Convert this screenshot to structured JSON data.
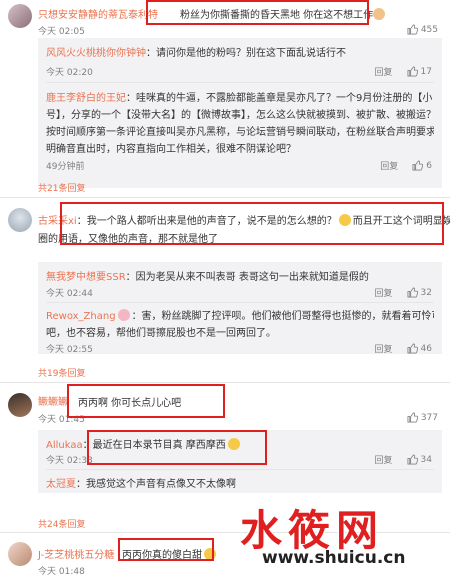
{
  "c1": {
    "name": "只想安安静静的蒂瓦泰利特",
    "text": "粉丝为你撕番撕的昏天黑地 你在这不想工作",
    "time": "今天 02:05",
    "likes": "455"
  },
  "c1_replies": [
    {
      "name": "风风火火桃桃你你钟钟",
      "text": "：请问你是他的粉吗？别在这下面乱说话行不",
      "time": "今天 02:20",
      "reply": "回复",
      "likes": "17"
    },
    {
      "name": "鹿王李舒白的王妃",
      "lines": [
        "：哇咪真的牛逼，不露脸都能盖章是吴亦凡了？一个9月份注册的【小",
        "号】，分享的一个【没带大名】的【微博故事】，怎么这么快就被摸到、被扩散、被搬运？且",
        "按时间顺序第一条评论直接叫吴亦凡黑称，与论坛营销号瞬间联动，在粉丝联合声明要求剧方",
        "明确音直出时，内容直指向工作相关，很难不阴谋论吧？"
      ],
      "time": "49分钟前",
      "reply": "回复",
      "likes": "6"
    }
  ],
  "c1_more": "共21条回复",
  "c2": {
    "name": "古采采xi",
    "lines": [
      "：我一个路人都听出来是他的声音了，说不是的怎么想的？",
      "而且开工这个词明显娱乐",
      "圈的用语，又像他的声音，那不就是他了"
    ]
  },
  "c2_replies": [
    {
      "name": "無我梦中想要SSR",
      "text": "：因为老吴从来不叫表哥 表哥这句一出来就知道是假的",
      "time": "今天 02:44",
      "reply": "回复",
      "likes": "32"
    },
    {
      "name": "Rewox_Zhang",
      "lines": [
        "：害，粉丝跳脚了控评呗。他们被他们哥整得也挺惨的，就看着可怜可怜",
        "吧，也不容易，帮他们哥擦屁股也不是一回两回了。"
      ],
      "time": "今天 02:55",
      "reply": "回复",
      "likes": "46"
    }
  ],
  "c2_more": "共19条回复",
  "c3": {
    "name": "鳜鳜鳜",
    "text": "丙丙啊 你可长点儿心吧",
    "time": "今天 01:45",
    "likes": "377"
  },
  "c3_replies": [
    {
      "name": "Allukaa",
      "text": "：最近在日本录节目真 摩西摩西",
      "time": "今天 02:33",
      "reply": "回复",
      "likes": "34"
    },
    {
      "name": "太冠夏",
      "text": "：我感觉这个声音有点像又不太像啊",
      "time": "",
      "reply": "",
      "likes": ""
    }
  ],
  "c3_more": "共24条回复",
  "c4": {
    "name": "J-芝芝桃桃五分糖",
    "text": "丙丙你真的傻白甜",
    "time": "今天 01:48"
  },
  "watermark": {
    "main": "水筱网",
    "url": "www.shuicu.cn"
  },
  "colors": {
    "name": "#eb7350",
    "highlight": "#e01f1f",
    "reply_bg": "#f2f2f5",
    "watermark": "#e02020"
  }
}
